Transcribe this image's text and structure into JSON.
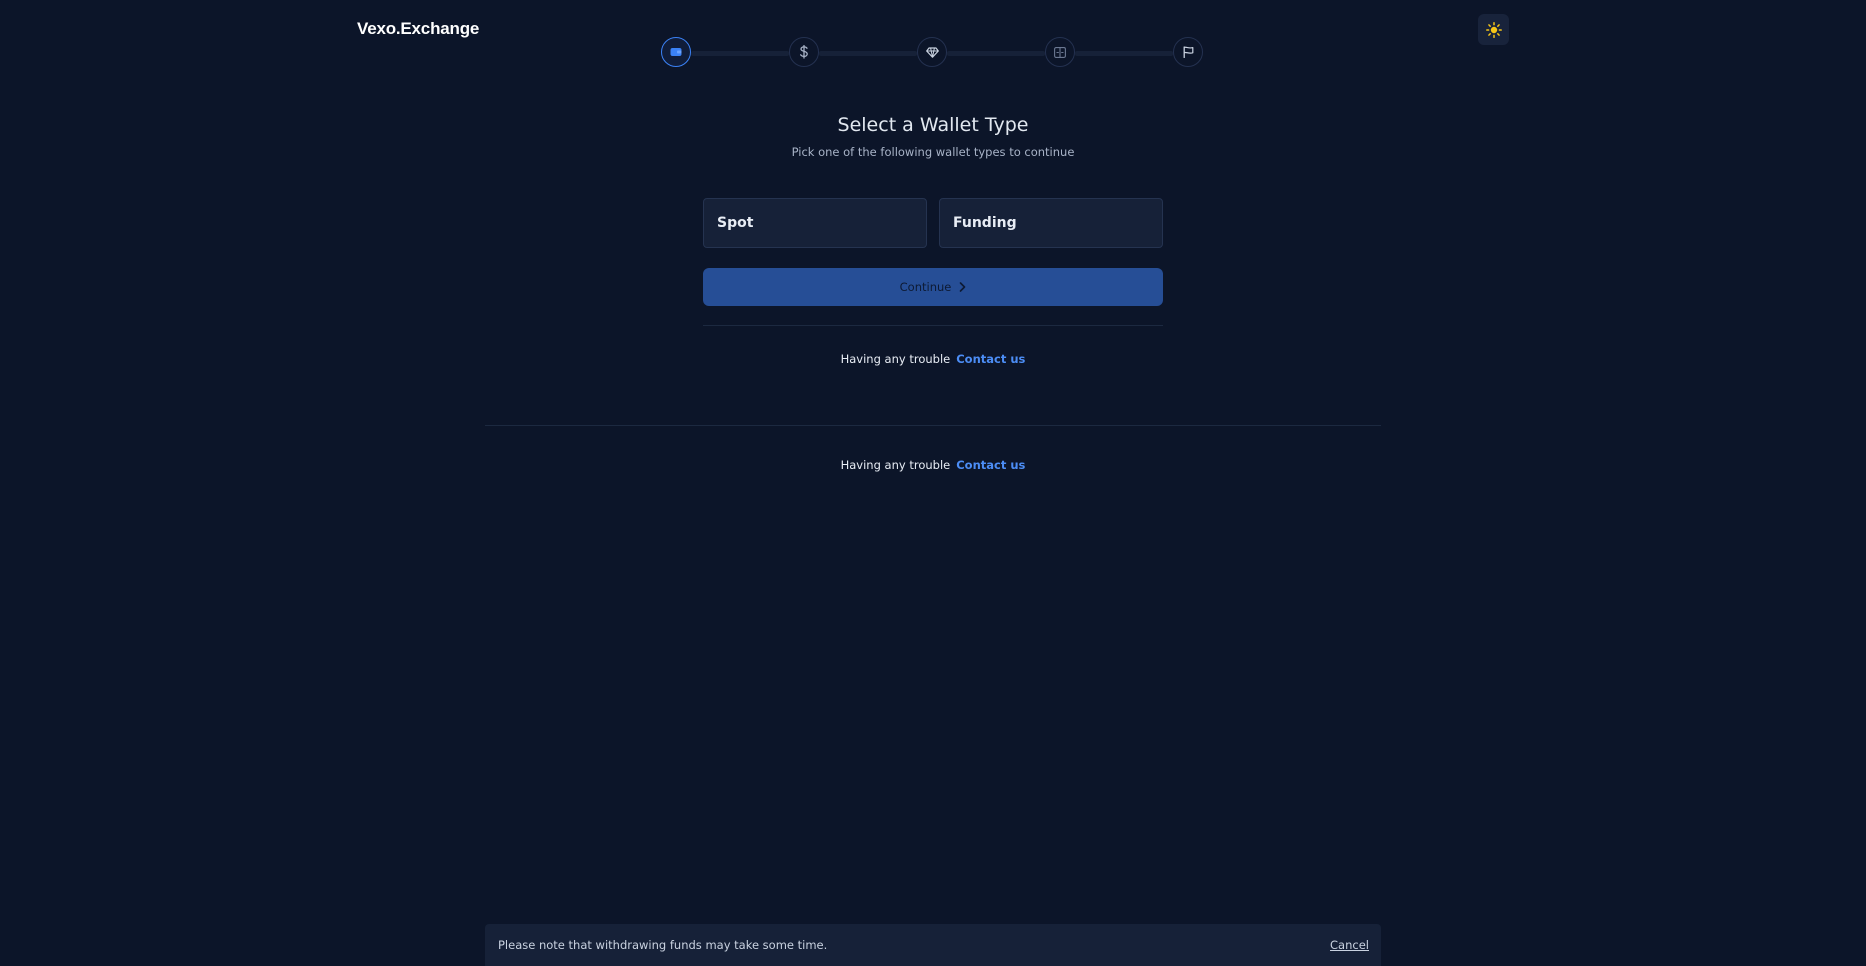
{
  "header": {
    "logo_text": "Vexo.Exchange",
    "theme_toggle_icon": "sun-icon"
  },
  "stepper": {
    "steps": [
      {
        "icon": "wallet-icon",
        "active": true
      },
      {
        "icon": "dollar-icon",
        "active": false
      },
      {
        "icon": "diamond-icon",
        "active": false
      },
      {
        "icon": "exchange-icon",
        "active": false
      },
      {
        "icon": "flag-icon",
        "active": false
      }
    ]
  },
  "main": {
    "title": "Select a Wallet Type",
    "subtitle": "Pick one of the following wallet types to continue",
    "options": [
      "Spot",
      "Funding"
    ],
    "continue_label": "Continue",
    "trouble_text": "Having any trouble",
    "contact_label": "Contact us"
  },
  "footer": {
    "trouble_text": "Having any trouble",
    "contact_label": "Contact us"
  },
  "notice": {
    "text": "Please note that withdrawing funds may take some time.",
    "cancel_label": "Cancel"
  },
  "colors": {
    "background": "#0c1529",
    "accent": "#3b82f6",
    "button": "#264e96",
    "link": "#4c8df5",
    "sun": "#f5c518"
  }
}
